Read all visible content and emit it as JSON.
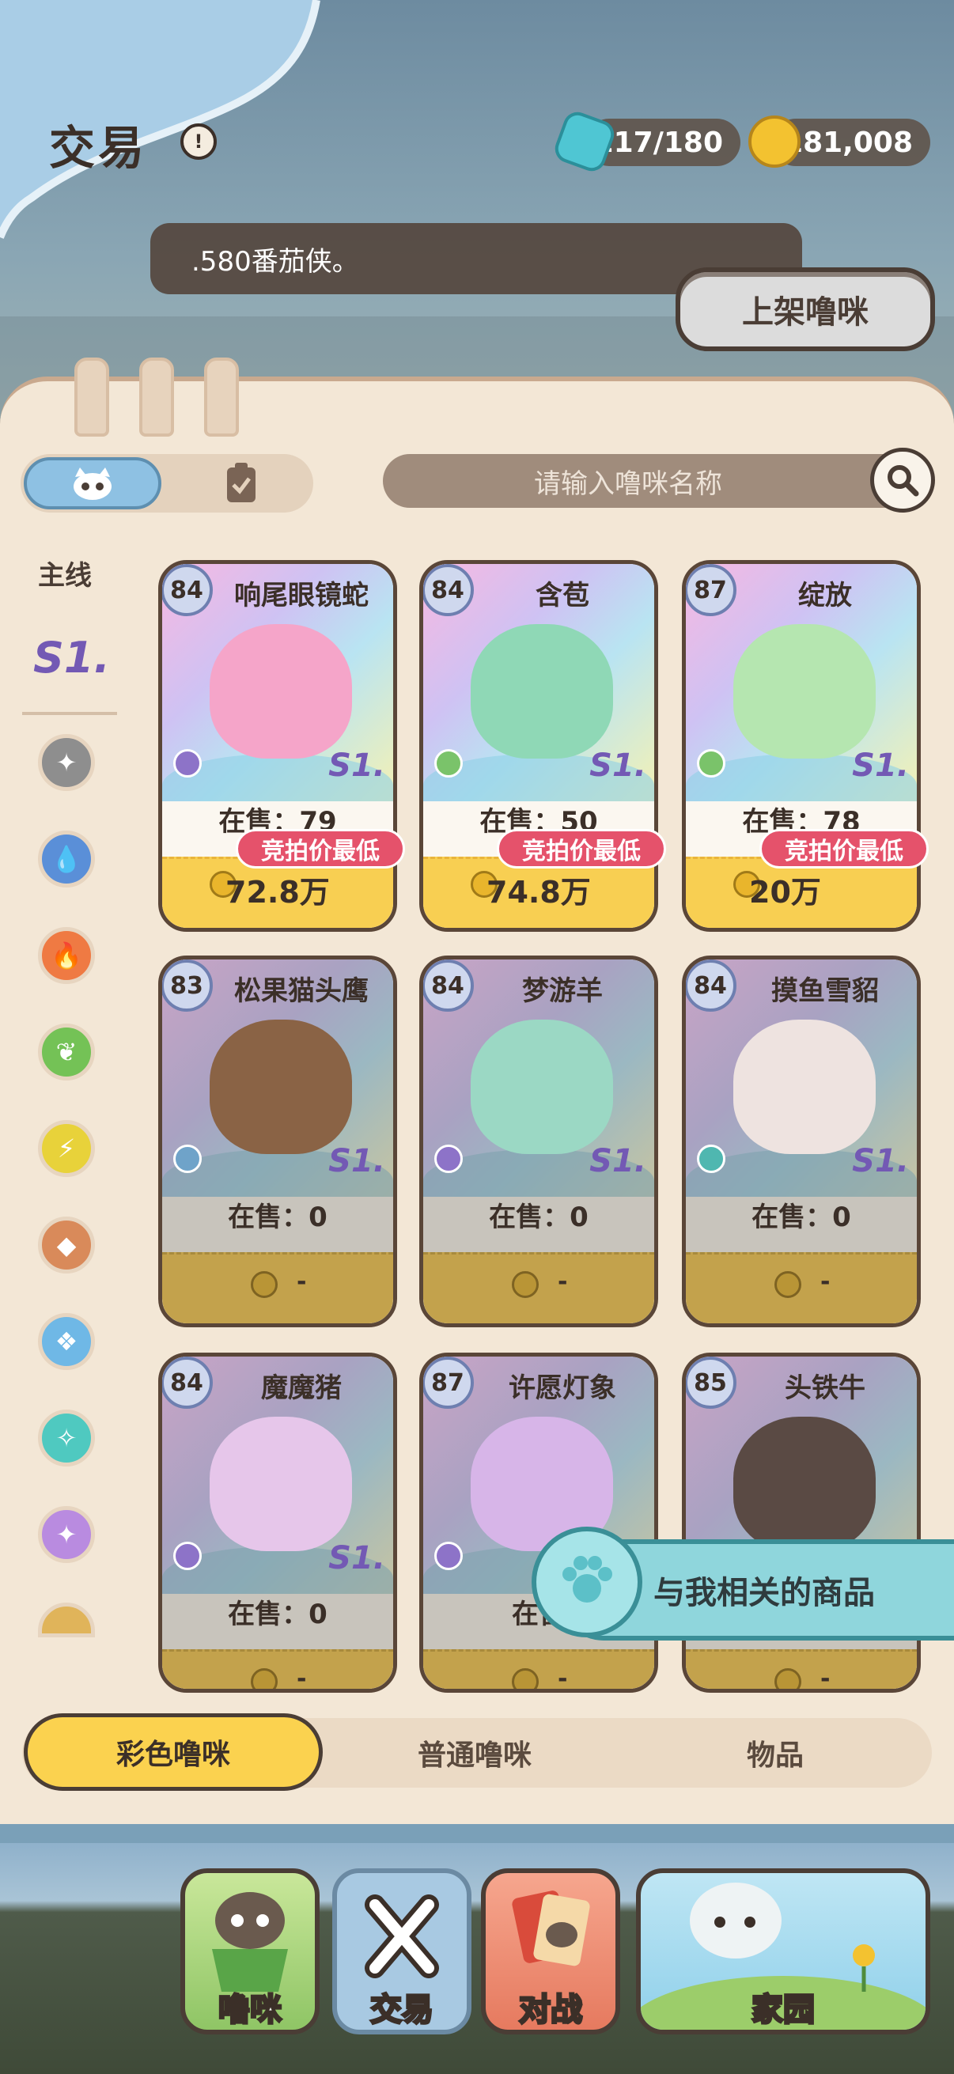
{
  "header": {
    "title": "交易",
    "info_icon": "info-icon",
    "energy": "117/180",
    "coins": "181,008",
    "ticker": ".580番茄侠。",
    "list_button": "上架噜咪"
  },
  "filters": {
    "search_placeholder": "请输入噜咪名称"
  },
  "sidebar": {
    "main_label": "主线",
    "s1_label": "S1.",
    "elements": [
      "normal",
      "water",
      "fire",
      "grass",
      "electric",
      "rock",
      "wind",
      "ice",
      "magic",
      "light"
    ]
  },
  "cards": [
    {
      "level": "84",
      "name": "响尾眼镜蛇",
      "stock": "在售：79",
      "bid": "竞拍价最低",
      "price": "72.8万",
      "tag": "S1.",
      "color": "#f5a5c9",
      "el": "#8d73c8"
    },
    {
      "level": "84",
      "name": "含苞",
      "stock": "在售：50",
      "bid": "竞拍价最低",
      "price": "74.8万",
      "tag": "S1.",
      "color": "#8fd8b6",
      "el": "#7ac36a"
    },
    {
      "level": "87",
      "name": "绽放",
      "stock": "在售：78",
      "bid": "竞拍价最低",
      "price": "20万",
      "tag": "S1.",
      "color": "#b5e6b0",
      "el": "#7ac36a"
    },
    {
      "level": "83",
      "name": "松果猫头鹰",
      "stock": "在售：0",
      "price": "-",
      "tag": "S1.",
      "color": "#8a6345",
      "el": "#6fa3c9"
    },
    {
      "level": "84",
      "name": "梦游羊",
      "stock": "在售：0",
      "price": "-",
      "tag": "S1.",
      "color": "#9bd8c4",
      "el": "#8d73c8"
    },
    {
      "level": "84",
      "name": "摸鱼雪貂",
      "stock": "在售：0",
      "price": "-",
      "tag": "S1.",
      "color": "#eee3e0",
      "el": "#4fb7b0"
    },
    {
      "level": "84",
      "name": "魔魔猪",
      "stock": "在售：0",
      "price": "-",
      "tag": "S1.",
      "color": "#e6c6ea",
      "el": "#8d73c8"
    },
    {
      "level": "87",
      "name": "许愿灯象",
      "stock": "在售",
      "price": "-",
      "tag": "",
      "color": "#d7b5e8",
      "el": "#8d73c8"
    },
    {
      "level": "85",
      "name": "头铁牛",
      "stock": "",
      "price": "-",
      "tag": "",
      "color": "#5a4a44",
      "el": "#6fa3c9"
    }
  ],
  "related_banner": "与我相关的商品",
  "category_tabs": [
    "彩色噜咪",
    "普通噜咪",
    "物品"
  ],
  "nav": [
    "噜咪",
    "交易",
    "对战",
    "家园"
  ]
}
